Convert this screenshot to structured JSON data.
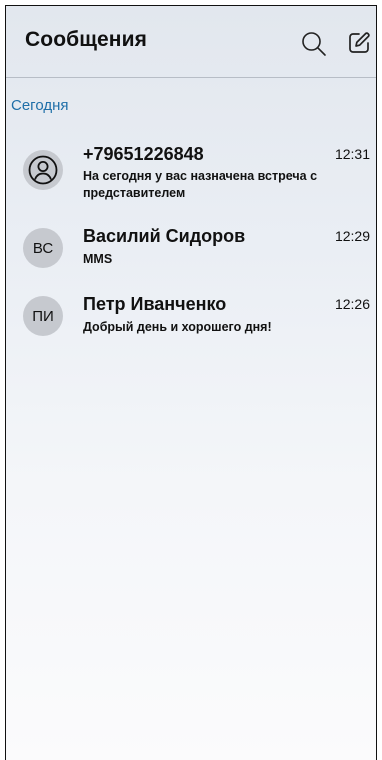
{
  "header": {
    "title": "Сообщения",
    "search_icon": "search-icon",
    "compose_icon": "compose-icon"
  },
  "section": {
    "label": "Сегодня"
  },
  "conversations": [
    {
      "name": "+79651226848",
      "avatar_icon": "person-icon",
      "time": "12:31",
      "preview": "На сегодня у вас назначена встреча с представителем"
    },
    {
      "name": "Василий Сидоров",
      "initials": "ВС",
      "time": "12:29",
      "preview": "MMS"
    },
    {
      "name": "Петр Иванченко",
      "initials": "ПИ",
      "time": "12:26",
      "preview": "Добрый день и хорошего дня!"
    }
  ]
}
